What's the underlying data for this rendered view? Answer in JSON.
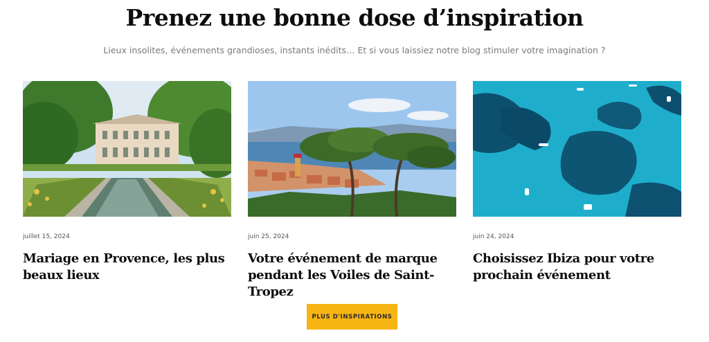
{
  "section": {
    "heading": "Prenez une bonne dose d’inspiration",
    "subtitle": "Lieux insolites, événements grandioses, instants inédits… Et si vous laissiez notre blog stimuler votre imagination ?"
  },
  "posts": [
    {
      "date": "juillet 15, 2024",
      "title": "Mariage en Provence, les plus beaux lieux",
      "image": "chateau-garden-pool-photo"
    },
    {
      "date": "juin 25, 2024",
      "title": "Votre événement de marque pendant les Voiles de Saint-Tropez",
      "image": "saint-tropez-pine-view-photo"
    },
    {
      "date": "juin 24, 2024",
      "title": "Choisissez Ibiza pour votre prochain événement",
      "image": "ibiza-turquoise-sea-photo"
    }
  ],
  "cta": {
    "label": "PLUS D'INSPIRATIONS",
    "color": "#f7b514"
  }
}
